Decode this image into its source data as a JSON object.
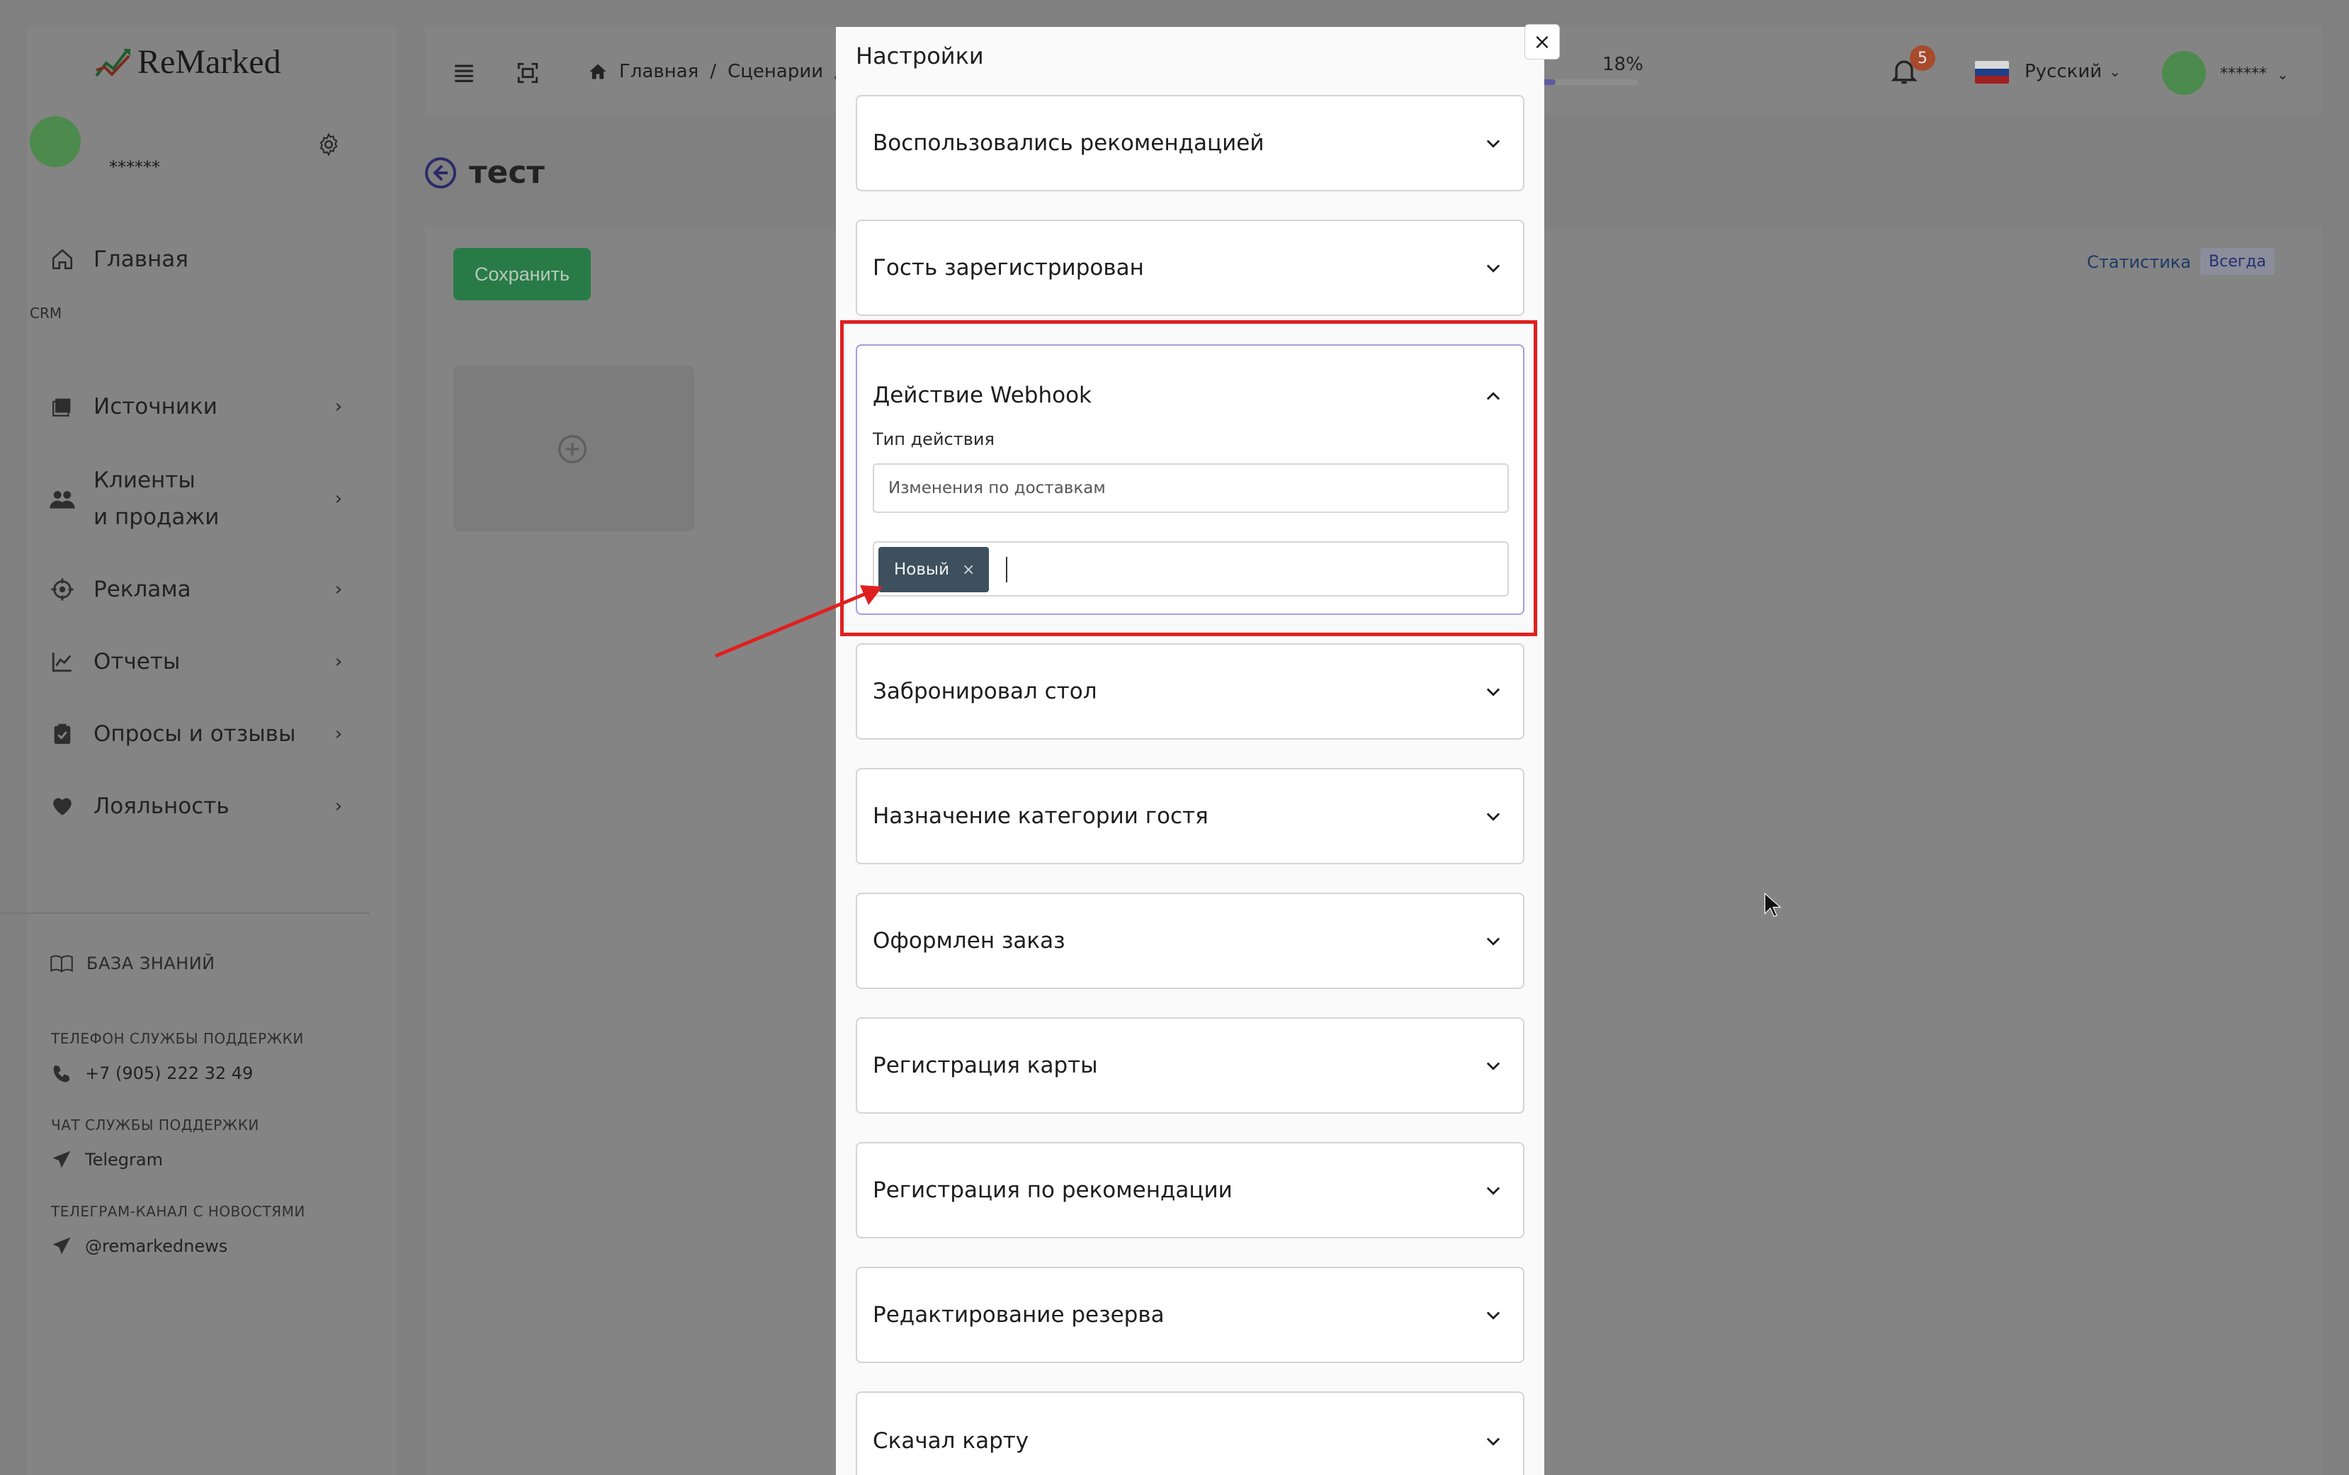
{
  "sidebar": {
    "brand": "ReMarked",
    "profile_name": "******",
    "crm_label": "CRM",
    "items": [
      {
        "label": "Главная"
      },
      {
        "label": "Источники"
      },
      {
        "label": "Клиенты\nи продажи"
      },
      {
        "label": "Реклама"
      },
      {
        "label": "Отчеты"
      },
      {
        "label": "Опросы и отзывы"
      },
      {
        "label": "Лояльность"
      }
    ],
    "knowledge_base": "БАЗА ЗНАНИЙ",
    "support_phone_label": "ТЕЛЕФОН СЛУЖБЫ ПОДДЕРЖКИ",
    "support_phone": "+7 (905) 222 32 49",
    "support_chat_label": "ЧАТ СЛУЖБЫ ПОДДЕРЖКИ",
    "support_chat": "Telegram",
    "news_label": "ТЕЛЕГРАМ-КАНАЛ С НОВОСТЯМИ",
    "news_channel": "@remarkednews"
  },
  "topbar": {
    "breadcrumb": [
      "Главная",
      "/",
      "Сценарии",
      "/"
    ],
    "progress_label": "18%",
    "progress_value": 0.18,
    "notifications_count": "5",
    "language": "Русский",
    "user_name": "******"
  },
  "page": {
    "title": "тест",
    "save_label": "Сохранить",
    "stats_link": "Статистика",
    "stats_badge": "Всегда"
  },
  "modal": {
    "title": "Настройки",
    "close_label": "×",
    "accordion": [
      {
        "title": "Воспользовались рекомендацией"
      },
      {
        "title": "Гость зарегистрирован"
      },
      {
        "title": "Действие Webhook",
        "expanded": true
      },
      {
        "title": "Забронировал стол"
      },
      {
        "title": "Назначение категории гостя"
      },
      {
        "title": "Оформлен заказ"
      },
      {
        "title": "Регистрация карты"
      },
      {
        "title": "Регистрация по рекомендации"
      },
      {
        "title": "Редактирование резерва"
      },
      {
        "title": "Скачал карту"
      }
    ],
    "action_type_label": "Тип действия",
    "action_type_value": "Изменения по доставкам",
    "tag_label": "Новый",
    "tag_remove": "×"
  },
  "colors": {
    "accent": "#5a52c8",
    "save_green": "#287b46",
    "highlight_red": "#e02020",
    "tag_bg": "#3e4f5d"
  }
}
